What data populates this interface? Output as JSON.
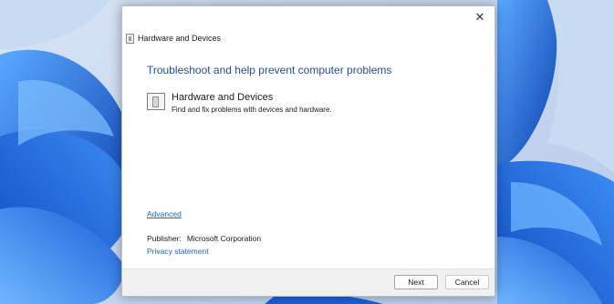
{
  "window": {
    "title": "Hardware and Devices",
    "close_glyph": "✕"
  },
  "content": {
    "heading": "Troubleshoot and help prevent computer problems",
    "item": {
      "title": "Hardware and Devices",
      "description": "Find and fix problems with devices and hardware.",
      "icon": "hardware-device-icon"
    },
    "advanced_link": "Advanced",
    "publisher_label": "Publisher:",
    "publisher_value": "Microsoft Corporation",
    "privacy_link": "Privacy statement"
  },
  "footer": {
    "next_label": "Next",
    "cancel_label": "Cancel"
  },
  "colors": {
    "heading": "#1f4e96",
    "link": "#1a66c2",
    "wallpaper": "#2a64c8"
  }
}
